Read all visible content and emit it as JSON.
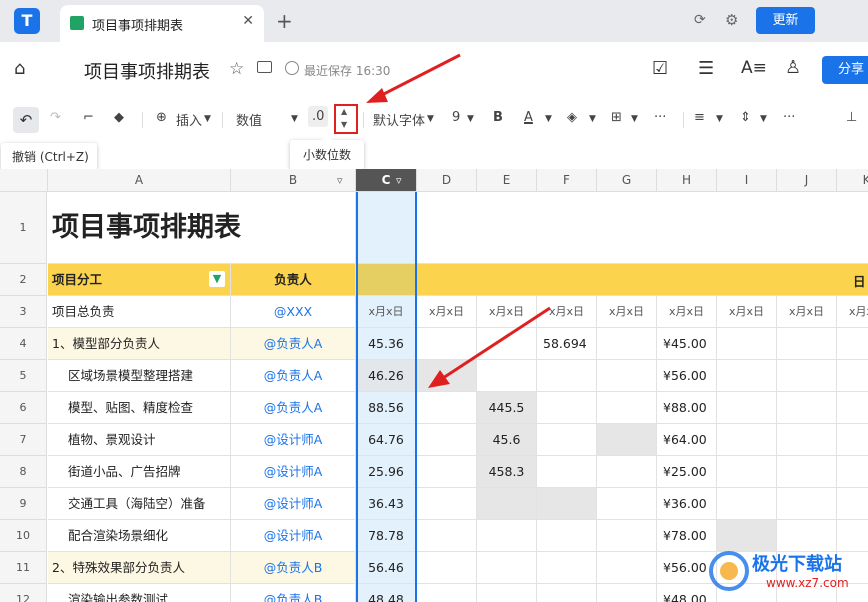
{
  "tabbar": {
    "app_logo": "T",
    "tab_title": "项目事项排期表",
    "close": "✕",
    "new_tab": "+",
    "refresh_icon": "refresh-icon",
    "settings_icon": "gear-icon",
    "update": "更新"
  },
  "header": {
    "title": "项目事项排期表",
    "saved": "最近保存 16:30",
    "share": "分享"
  },
  "toolbar": {
    "insert": "插入",
    "format": "数值",
    "decimal": ".0",
    "font": "默认字体",
    "size": "9",
    "bold": "B",
    "color": "A",
    "more": "···"
  },
  "tooltips": {
    "undo": "撤销 (Ctrl+Z)",
    "decimal": "小数位数"
  },
  "columns": [
    "A",
    "B",
    "C",
    "D",
    "E",
    "F",
    "G",
    "H",
    "I",
    "J",
    "K"
  ],
  "sheet": {
    "title": "项目事项排期表",
    "r2": {
      "a": "项目分工",
      "b": "负责人",
      "k": "日"
    },
    "r3": {
      "a": "项目总负责",
      "b": "@XXX",
      "dates": [
        "x月x日",
        "x月x日",
        "x月x日",
        "x月x日",
        "x月x日",
        "x月x日",
        "x月x日",
        "x月x日",
        "x月x日"
      ]
    },
    "rows": [
      {
        "n": "4",
        "a": "1、模型部分负责人",
        "b": "@负责人A",
        "c": "45.36",
        "e": "",
        "f": "58.694",
        "h": "¥45.00",
        "lead": true
      },
      {
        "n": "5",
        "a": "区域场景模型整理搭建",
        "b": "@负责人A",
        "c": "46.26",
        "e": "",
        "f": "",
        "h": "¥56.00"
      },
      {
        "n": "6",
        "a": "模型、贴图、精度检查",
        "b": "@负责人A",
        "c": "88.56",
        "e": "445.5",
        "f": "",
        "h": "¥88.00"
      },
      {
        "n": "7",
        "a": "植物、景观设计",
        "b": "@设计师A",
        "c": "64.76",
        "e": "45.6",
        "f": "",
        "h": "¥64.00"
      },
      {
        "n": "8",
        "a": "街道小品、广告招牌",
        "b": "@设计师A",
        "c": "25.96",
        "e": "458.3",
        "f": "",
        "h": "¥25.00"
      },
      {
        "n": "9",
        "a": "交通工具（海陆空）准备",
        "b": "@设计师A",
        "c": "36.43",
        "e": "",
        "f": "",
        "h": "¥36.00"
      },
      {
        "n": "10",
        "a": "配合渲染场景细化",
        "b": "@设计师A",
        "c": "78.78",
        "e": "",
        "f": "",
        "h": "¥78.00"
      },
      {
        "n": "11",
        "a": "2、特殊效果部分负责人",
        "b": "@负责人B",
        "c": "56.46",
        "e": "",
        "f": "",
        "h": "¥56.00",
        "lead": true
      },
      {
        "n": "12",
        "a": "渲染输出参数测试",
        "b": "@负责人B",
        "c": "48.48",
        "e": "",
        "f": "",
        "h": "¥48.00"
      }
    ]
  },
  "watermark": {
    "name": "极光下载站",
    "url": "www.xz7.com"
  }
}
